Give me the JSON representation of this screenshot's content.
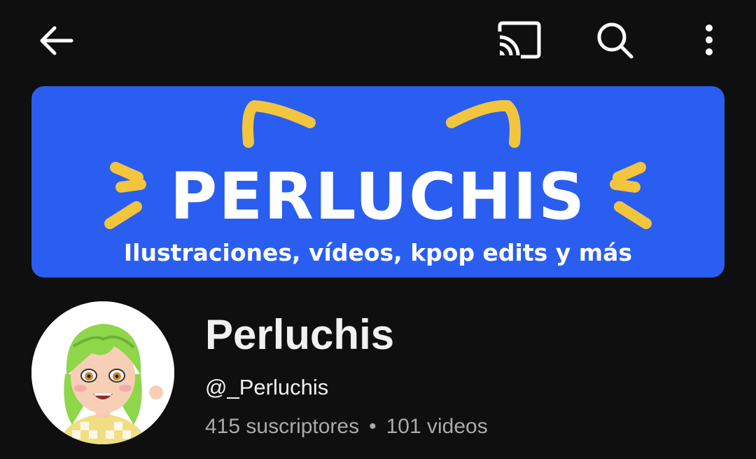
{
  "header": {
    "back_icon": "arrow-left-icon",
    "cast_icon": "cast-icon",
    "search_icon": "search-icon",
    "more_icon": "more-vertical-icon"
  },
  "banner": {
    "title": "PERLUCHIS",
    "subtitle": "Ilustraciones, vídeos, kpop edits y más",
    "background_color": "#2a5ef0",
    "accent_color": "#f2c53d"
  },
  "channel": {
    "name": "Perluchis",
    "handle": "@_Perluchis",
    "subscribers": "415 suscriptores",
    "separator": "•",
    "videos": "101 videos"
  },
  "colors": {
    "background": "#0f0f0f",
    "text_primary": "#f1f1f1",
    "text_secondary": "#aaaaaa"
  }
}
